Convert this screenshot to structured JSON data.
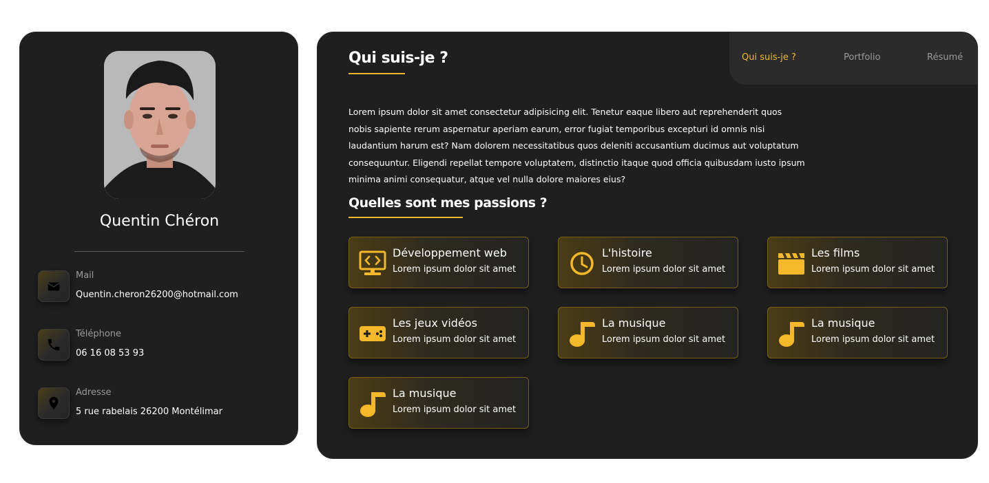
{
  "profile": {
    "name": "Quentin Chéron",
    "contacts": [
      {
        "label": "Mail",
        "value": "Quentin.cheron26200@hotmail.com",
        "icon": "mail-icon"
      },
      {
        "label": "Téléphone",
        "value": "06 16 08 53 93",
        "icon": "phone-icon"
      },
      {
        "label": "Adresse",
        "value": "5 rue rabelais 26200 Montélimar",
        "icon": "location-pin-icon"
      }
    ]
  },
  "nav": {
    "items": [
      "Qui suis-je ?",
      "Portfolio",
      "Résumé"
    ],
    "active": "Qui suis-je ?"
  },
  "about": {
    "title": "Qui suis-je ?",
    "text": "Lorem ipsum dolor sit amet consectetur adipisicing elit. Tenetur eaque libero aut reprehenderit quos nobis sapiente rerum aspernatur aperiam earum, error fugiat temporibus excepturi id omnis nisi laudantium harum est? Nam dolorem necessitatibus quos deleniti accusantium ducimus aut voluptatum consequuntur. Eligendi repellat tempore voluptatem, distinctio itaque quod officia quibusdam iusto ipsum minima animi consequatur, atque vel nulla dolore maiores eius?"
  },
  "passions": {
    "title": "Quelles sont mes passions ?",
    "items": [
      {
        "title": "Développement web",
        "desc": "Lorem ipsum dolor sit amet",
        "icon": "code-monitor-icon"
      },
      {
        "title": "L'histoire",
        "desc": "Lorem ipsum dolor sit amet",
        "icon": "clock-icon"
      },
      {
        "title": "Les films",
        "desc": "Lorem ipsum dolor sit amet",
        "icon": "clapperboard-icon"
      },
      {
        "title": "Les jeux vidéos",
        "desc": "Lorem ipsum dolor sit amet",
        "icon": "gamepad-icon"
      },
      {
        "title": "La musique",
        "desc": "Lorem ipsum dolor sit amet",
        "icon": "music-note-icon"
      },
      {
        "title": "La musique",
        "desc": "Lorem ipsum dolor sit amet",
        "icon": "music-note-icon"
      },
      {
        "title": "La musique",
        "desc": "Lorem ipsum dolor sit amet",
        "icon": "music-note-icon"
      }
    ]
  },
  "colors": {
    "accent": "#f5b82a",
    "panel": "#1f1f1f",
    "nav_bg": "#2b2b2b"
  }
}
